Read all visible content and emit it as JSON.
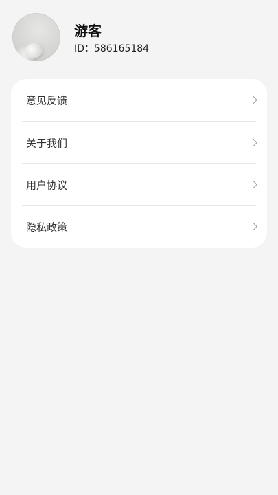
{
  "profile": {
    "username": "游客",
    "user_id": "ID：586165184"
  },
  "menu": {
    "items": [
      {
        "label": "意见反馈",
        "icon": "chevron-right-icon"
      },
      {
        "label": "关于我们",
        "icon": "chevron-right-icon"
      },
      {
        "label": "用户协议",
        "icon": "chevron-right-icon"
      },
      {
        "label": "隐私政策",
        "icon": "chevron-right-icon"
      }
    ]
  },
  "colors": {
    "background": "#f4f4f4",
    "card": "#ffffff",
    "divider": "#e8e8e8",
    "text_primary": "#111111",
    "text_secondary": "#333333",
    "chevron": "#9a9a9a"
  }
}
